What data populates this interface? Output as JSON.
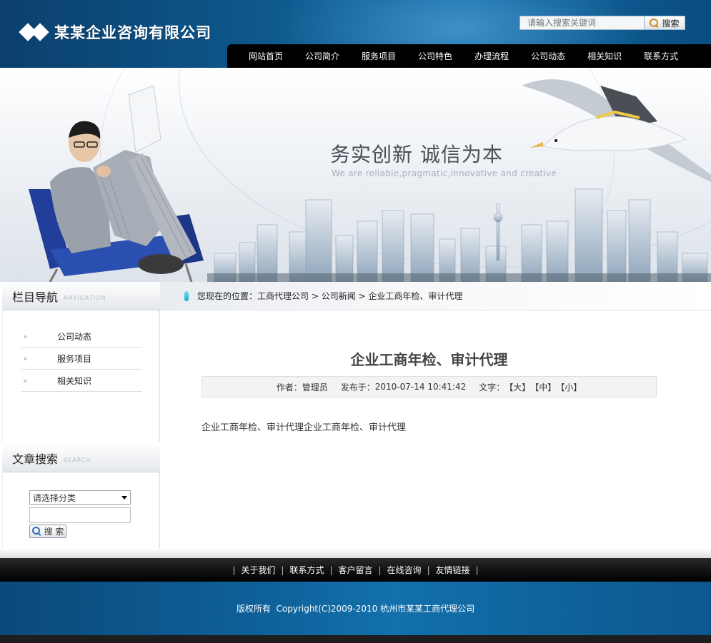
{
  "header": {
    "company_name": "某某企业咨询有限公司",
    "search_placeholder": "请输入搜索关键词",
    "search_button": "搜索"
  },
  "nav": [
    "网站首页",
    "公司简介",
    "服务项目",
    "公司特色",
    "办理流程",
    "公司动态",
    "相关知识",
    "联系方式"
  ],
  "banner": {
    "slogan": "务实创新 诚信为本",
    "slogan_en": "We are reliable,pragmatic,innovative and creative"
  },
  "sidebar": {
    "nav_title": "栏目导航",
    "nav_subtitle": "NAVIGATION",
    "items": [
      {
        "arrow": "»",
        "label": "公司动态"
      },
      {
        "arrow": "»",
        "label": "服务项目"
      },
      {
        "arrow": "»",
        "label": "相关知识"
      }
    ],
    "search_title": "文章搜索",
    "search_subtitle": "SEARCH",
    "category_selected": "请选择分类",
    "search_button": "搜 索"
  },
  "breadcrumb": {
    "prefix": "您现在的位置：",
    "parts": [
      "工商代理公司",
      "公司新闻",
      "企业工商年检、审计代理"
    ],
    "separator": " > "
  },
  "article": {
    "title": "企业工商年检、审计代理",
    "author_label": "作者：",
    "author": "管理员",
    "published_label": "发布于：",
    "published": "2010-07-14 10:41:42",
    "size_label": "文字：",
    "size_large": "【大】",
    "size_medium": "【中】",
    "size_small": "【小】",
    "body": "企业工商年检、审计代理企业工商年检、审计代理"
  },
  "footer": {
    "links": [
      "关于我们",
      "联系方式",
      "客户留言",
      "在线咨询",
      "友情链接"
    ],
    "copyright": "版权所有  Copyright(C)2009-2010 杭州市某某工商代理公司"
  }
}
